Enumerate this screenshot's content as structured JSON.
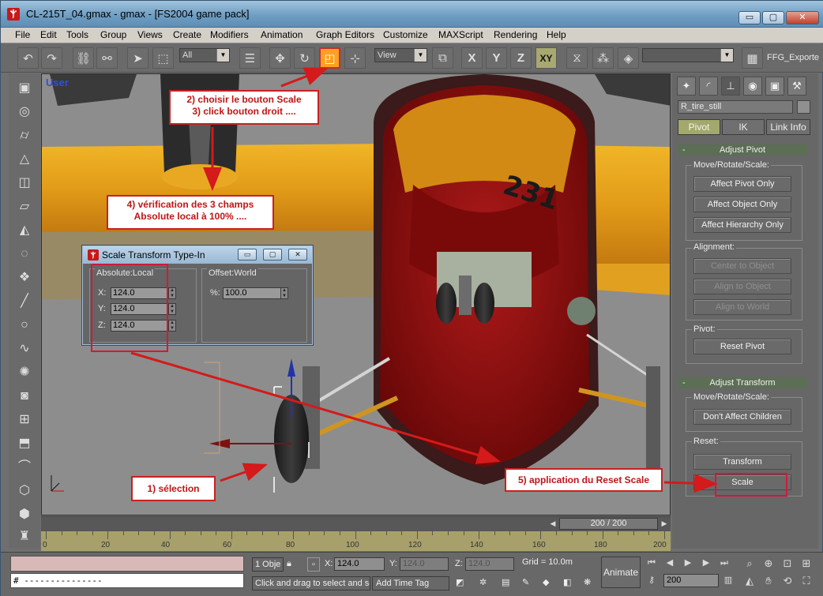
{
  "window": {
    "title": "CL-215T_04.gmax - gmax - [FS2004 game pack]",
    "min_glyph": "▭",
    "max_glyph": "▢",
    "close_glyph": "✕"
  },
  "menubar": {
    "items": [
      "File",
      "Edit",
      "Tools",
      "Group",
      "Views",
      "Create",
      "Modifiers",
      "Animation",
      "Graph Editors",
      "Customize",
      "MAXScript",
      "Rendering",
      "Help"
    ]
  },
  "toolbar": {
    "selection_filter": "All",
    "reference_coord": "View",
    "axis_x": "X",
    "axis_y": "Y",
    "axis_z": "Z",
    "axis_xy": "XY",
    "named_selection": "",
    "exporter_label": "FFG_Exporte"
  },
  "viewport": {
    "label": "User"
  },
  "scale_dialog": {
    "title": "Scale Transform Type-In",
    "absolute_label": "Absolute:Local",
    "offset_label": "Offset:World",
    "x_label": "X:",
    "y_label": "Y:",
    "z_label": "Z:",
    "x_value": "124.0",
    "y_value": "124.0",
    "z_value": "124.0",
    "percent_label": "%:",
    "percent_value": "100.0"
  },
  "command_panel": {
    "object_name": "R_tire_still",
    "mode_tabs": [
      "Pivot",
      "IK",
      "Link Info"
    ],
    "adjust_pivot_title": "Adjust Pivot",
    "move_rotate_scale_label": "Move/Rotate/Scale:",
    "affect_pivot_only": "Affect Pivot Only",
    "affect_object_only": "Affect Object Only",
    "affect_hierarchy_only": "Affect Hierarchy Only",
    "alignment_label": "Alignment:",
    "center_to_object": "Center to Object",
    "align_to_object": "Align to Object",
    "align_to_world": "Align to World",
    "pivot_label": "Pivot:",
    "reset_pivot": "Reset Pivot",
    "adjust_transform_title": "Adjust Transform",
    "move_rotate_scale_label_2": "Move/Rotate/Scale:",
    "dont_affect_children": "Don't Affect Children",
    "reset_label": "Reset:",
    "transform_button": "Transform",
    "scale_button": "Scale",
    "rollout_minus": "-"
  },
  "timeline": {
    "frame_readout": "200 / 200",
    "tick_labels": [
      "0",
      "20",
      "40",
      "60",
      "80",
      "100",
      "120",
      "140",
      "160",
      "180",
      "200"
    ]
  },
  "status_bar": {
    "maxscript_line": "# ---------------",
    "selection_count": "1 Obje",
    "x_label": "X:",
    "x_value": "124.0",
    "y_label": "Y:",
    "y_value": "124.0",
    "z_label": "Z:",
    "z_value": "124.0",
    "grid": "Grid = 10.0m",
    "prompt": "Click and drag to select and sc",
    "add_time_tag": "Add Time Tag",
    "animate": "Animate",
    "current_frame": "200"
  },
  "annotations": {
    "step1": "1) sélection",
    "step2a": "2) choisir le bouton Scale",
    "step2b": "3) click bouton droit ....",
    "step4a": "4) vérification des 3 champs",
    "step4b": "Absolute local à 100% ....",
    "step5": "5) application du Reset Scale",
    "color": "#c92020"
  },
  "scene": {
    "fuselage_red": "#8e0c12",
    "wing_yellow": "#e2a020",
    "background_gray": "#8d8d8d",
    "number_marking": "231"
  }
}
